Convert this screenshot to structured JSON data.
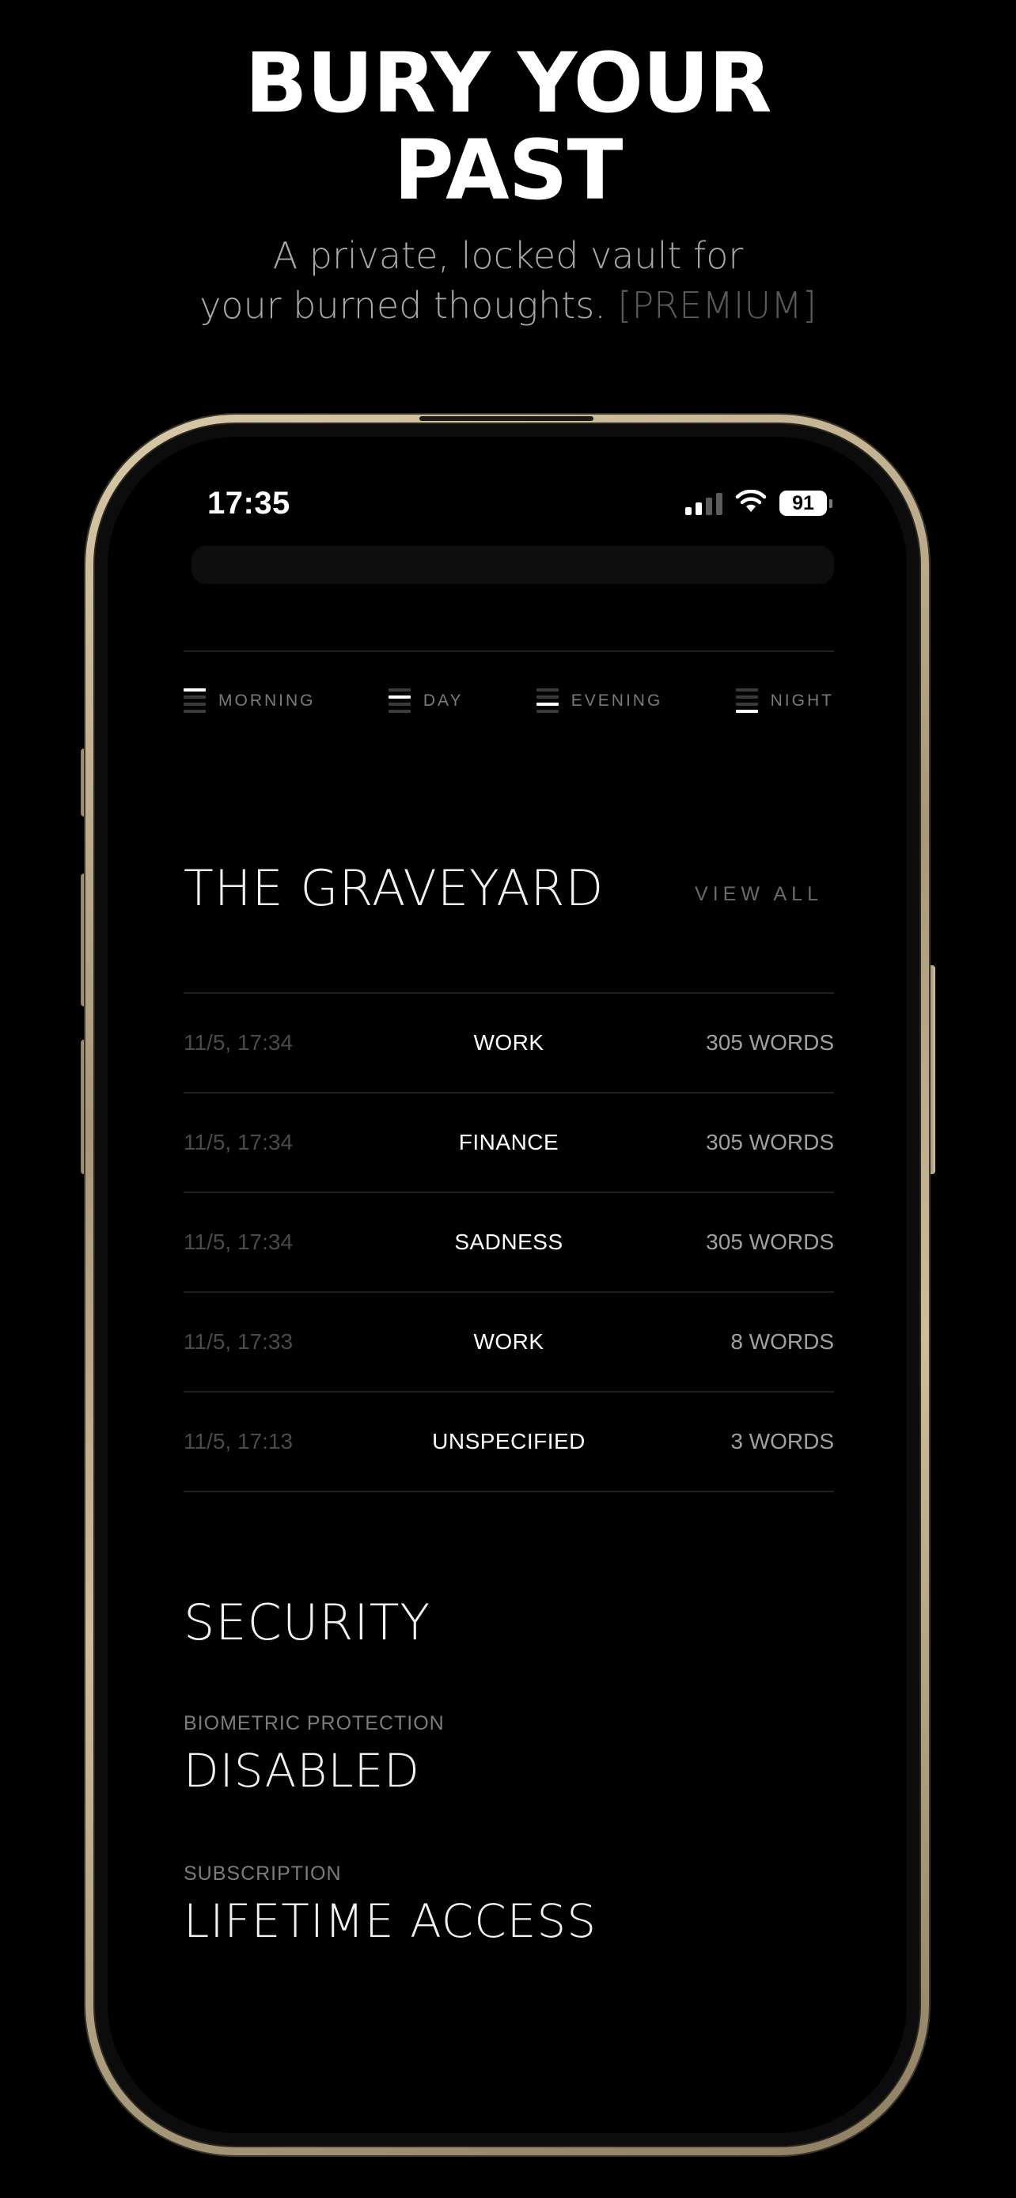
{
  "promo": {
    "headline_line1": "BURY YOUR",
    "headline_line2": "PAST",
    "sub_line1": "A private, locked vault for",
    "sub_line2": "your burned thoughts.",
    "sub_badge": "[PREMIUM]"
  },
  "status_bar": {
    "time": "17:35",
    "battery": "91",
    "icons": [
      "signal-icon",
      "wifi-icon",
      "battery-icon"
    ]
  },
  "time_filters": [
    {
      "label": "MORNING",
      "icon": "morning-bars-icon"
    },
    {
      "label": "DAY",
      "icon": "day-bars-icon"
    },
    {
      "label": "EVENING",
      "icon": "evening-bars-icon"
    },
    {
      "label": "NIGHT",
      "icon": "night-bars-icon"
    }
  ],
  "graveyard": {
    "title": "THE GRAVEYARD",
    "view_all": "VIEW ALL",
    "entries": [
      {
        "date": "11/5, 17:34",
        "category": "WORK",
        "words": "305 WORDS"
      },
      {
        "date": "11/5, 17:34",
        "category": "FINANCE",
        "words": "305 WORDS"
      },
      {
        "date": "11/5, 17:34",
        "category": "SADNESS",
        "words": "305 WORDS"
      },
      {
        "date": "11/5, 17:33",
        "category": "WORK",
        "words": "8 WORDS"
      },
      {
        "date": "11/5, 17:13",
        "category": "UNSPECIFIED",
        "words": "3 WORDS"
      }
    ]
  },
  "security": {
    "title": "SECURITY",
    "biometric_label": "BIOMETRIC PROTECTION",
    "biometric_value": "DISABLED",
    "subscription_label": "SUBSCRIPTION",
    "subscription_value": "LIFETIME ACCESS"
  },
  "colors": {
    "background": "#000000",
    "frame_gold": "#c9b993",
    "muted_text": "#7a7a7a",
    "divider": "#1f1f1f"
  }
}
